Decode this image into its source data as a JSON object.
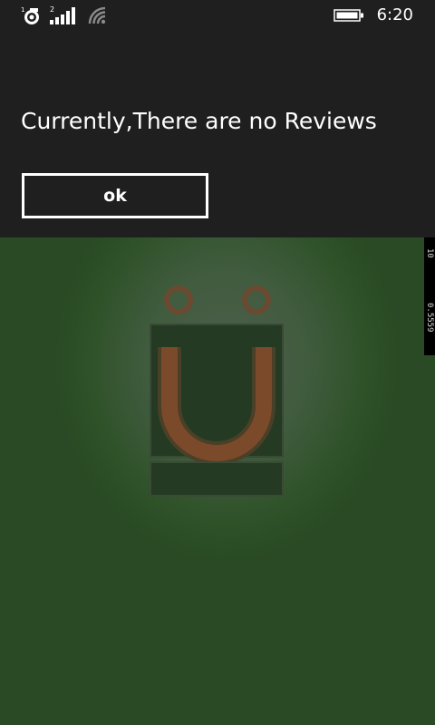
{
  "status_bar": {
    "time": "6:20",
    "data_icon": "data-connection-icon",
    "signal_icon": "signal-strength-icon",
    "wifi_icon": "wifi-icon",
    "battery_icon": "battery-icon",
    "signal_badge": "2",
    "data_badge": "1"
  },
  "dialog": {
    "message": "Currently,There are no Reviews",
    "ok_label": "ok"
  },
  "background_app": {
    "logo_icon": "app-logo-icon",
    "side_readout_top": "10",
    "side_readout_bottom": "0.5559"
  },
  "colors": {
    "dialog_bg": "#1f1f1f",
    "app_bg": "#2f5229",
    "logo_accent": "#7a4a2a"
  }
}
